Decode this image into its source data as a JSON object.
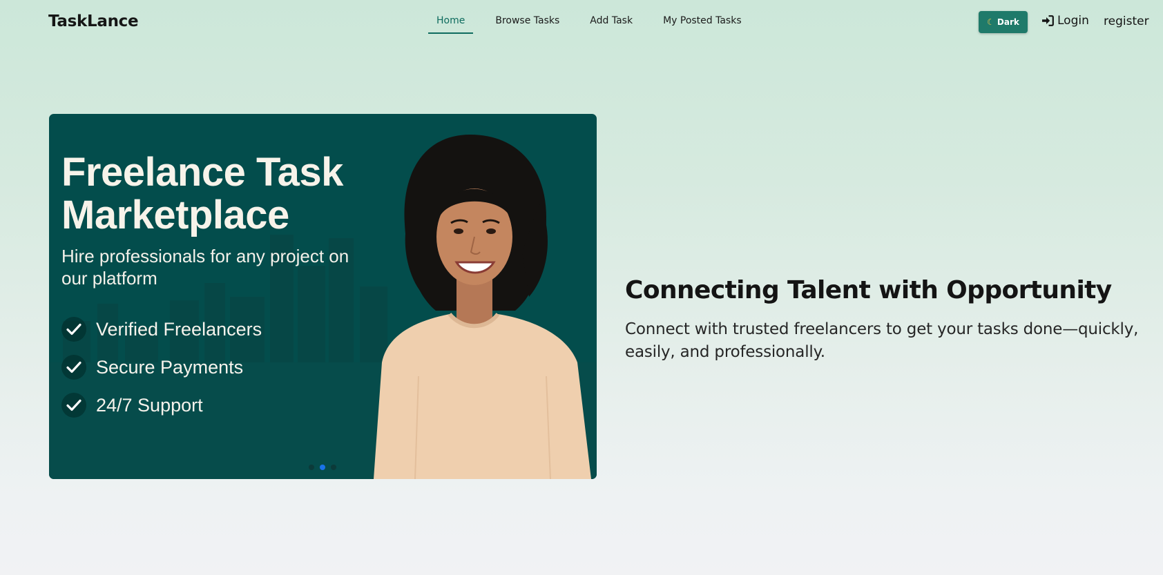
{
  "navbar": {
    "brand": "TaskLance",
    "links": [
      {
        "label": "Home",
        "active": true
      },
      {
        "label": "Browse Tasks",
        "active": false
      },
      {
        "label": "Add Task",
        "active": false
      },
      {
        "label": "My Posted Tasks",
        "active": false
      }
    ],
    "theme_toggle": {
      "label": "Dark",
      "icon": "moon-icon"
    },
    "login": {
      "label": "Login",
      "icon": "sign-in-icon"
    },
    "register": "register"
  },
  "carousel": {
    "title": "Freelance Task Marketplace",
    "subtitle": "Hire professionals for any project on our platform",
    "features": [
      {
        "label": "Verified Freelancers",
        "icon": "check-icon"
      },
      {
        "label": "Secure Payments",
        "icon": "check-icon"
      },
      {
        "label": "24/7 Support",
        "icon": "check-icon"
      }
    ],
    "slide_count": 3,
    "active_slide": 2
  },
  "hero": {
    "heading": "Connecting Talent with Opportunity",
    "text": "Connect with trusted freelancers to get your tasks done—quickly, easily, and professionally."
  },
  "colors": {
    "accent": "#1f7a6a",
    "slide_background": "#034d4c",
    "active_dot": "#1a73e8"
  }
}
